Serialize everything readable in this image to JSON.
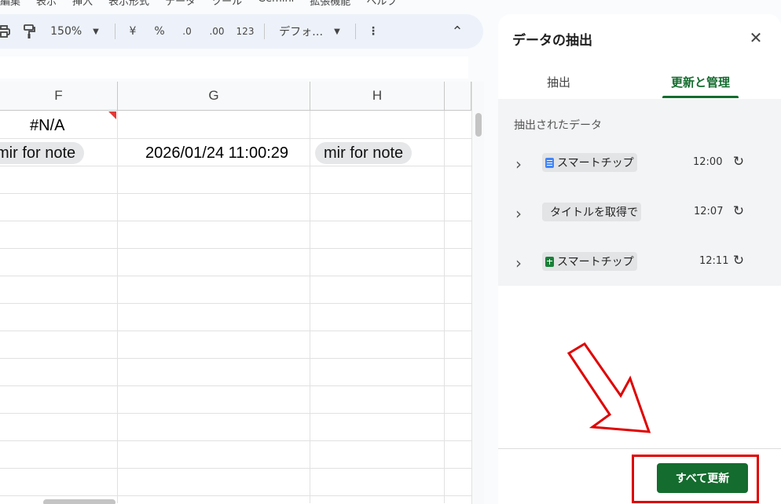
{
  "menubar": [
    "編集",
    "表示",
    "挿入",
    "表示形式",
    "データ",
    "ツール",
    "Gemini",
    "拡張機能",
    "ヘルプ"
  ],
  "toolbar": {
    "zoom": "150%",
    "currency": "¥",
    "percent": "%",
    "decrease_decimal": ".0",
    "increase_decimal": ".00",
    "number_format": "123",
    "font": "デフォ…",
    "more": "⋮",
    "collapse": "⌃"
  },
  "columns": [
    "F",
    "G",
    "H"
  ],
  "cells": {
    "f1": "#N/A",
    "f2_chip": "mir for note",
    "g2": "2026/01/24 11:00:29",
    "h2_chip": "mir for note"
  },
  "panel": {
    "title": "データの抽出",
    "close": "✕",
    "tabs": [
      "抽出",
      "更新と管理"
    ],
    "active_tab": 1,
    "section_label": "抽出されたデータ",
    "items": [
      {
        "label": "スマートチップ",
        "icon": "docs-icon",
        "time": "12:00"
      },
      {
        "label": "タイトルを取得で",
        "icon": "",
        "time": "12:07"
      },
      {
        "label": "スマートチップ",
        "icon": "sheets-icon",
        "time": "12:11"
      }
    ],
    "update_all": "すべて更新"
  },
  "colors": {
    "accent": "#146c2e",
    "highlight": "#e00000",
    "toolbar_bg": "#edf2fa"
  }
}
